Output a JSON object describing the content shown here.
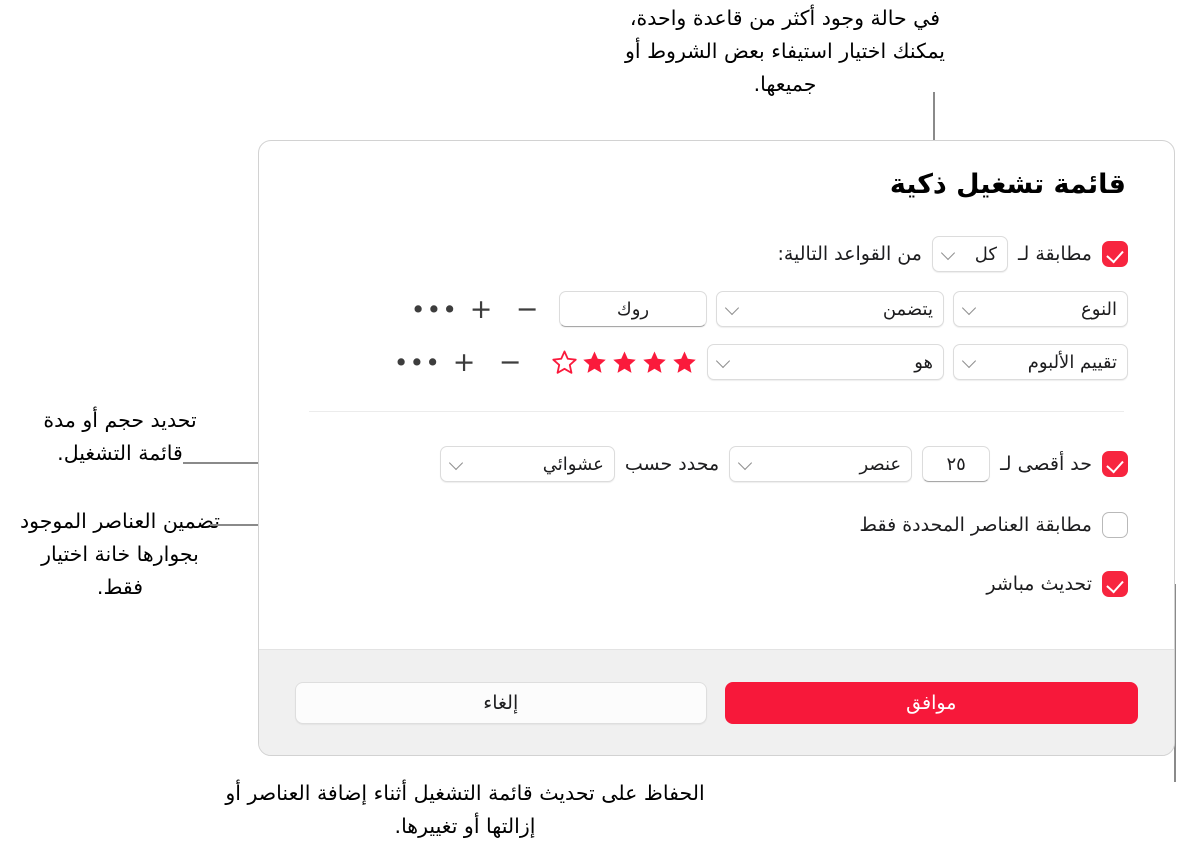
{
  "annotations": {
    "top": "في حالة وجود أكثر من قاعدة واحدة، يمكنك اختيار استيفاء بعض الشروط أو جميعها.",
    "limit": "تحديد حجم أو مدة قائمة التشغيل.",
    "checkbox_only": "تضمين العناصر الموجود بجوارها خانة اختيار فقط.",
    "live_update": "الحفاظ على تحديث قائمة التشغيل أثناء إضافة العناصر أو إزالتها أو تغييرها."
  },
  "dialog": {
    "title": "قائمة تشغيل ذكية",
    "match": {
      "checkbox_checked": true,
      "label_before": "مطابقة لـ",
      "selected_option": "كل",
      "label_after": "من القواعد التالية:"
    },
    "rules": [
      {
        "field": "النوع",
        "operator": "يتضمن",
        "value_type": "text",
        "value": "روك",
        "actions": {
          "remove": "−",
          "add": "+",
          "more": "•••"
        }
      },
      {
        "field": "تقييم الألبوم",
        "operator": "هو",
        "value_type": "stars",
        "stars_filled": 4,
        "stars_total": 5,
        "actions": {
          "remove": "−",
          "add": "+",
          "more": "•••"
        }
      }
    ],
    "limit": {
      "checkbox_checked": true,
      "label_prefix": "حد أقصى لـ",
      "amount": "٢٥",
      "unit": "عنصر",
      "label_middle": "محدد حسب",
      "order": "عشوائي"
    },
    "selected_only": {
      "checkbox_checked": false,
      "label": "مطابقة العناصر المحددة فقط"
    },
    "live_update": {
      "checkbox_checked": true,
      "label": "تحديث مباشر"
    },
    "footer": {
      "ok_label": "موافق",
      "cancel_label": "إلغاء"
    }
  },
  "colors": {
    "accent_red": "#f7183a",
    "checkbox_red": "#f7253f",
    "star_red": "#fa1a3c",
    "leader_gray": "#8a8a8a",
    "footer_bg": "#f0f0f0"
  }
}
